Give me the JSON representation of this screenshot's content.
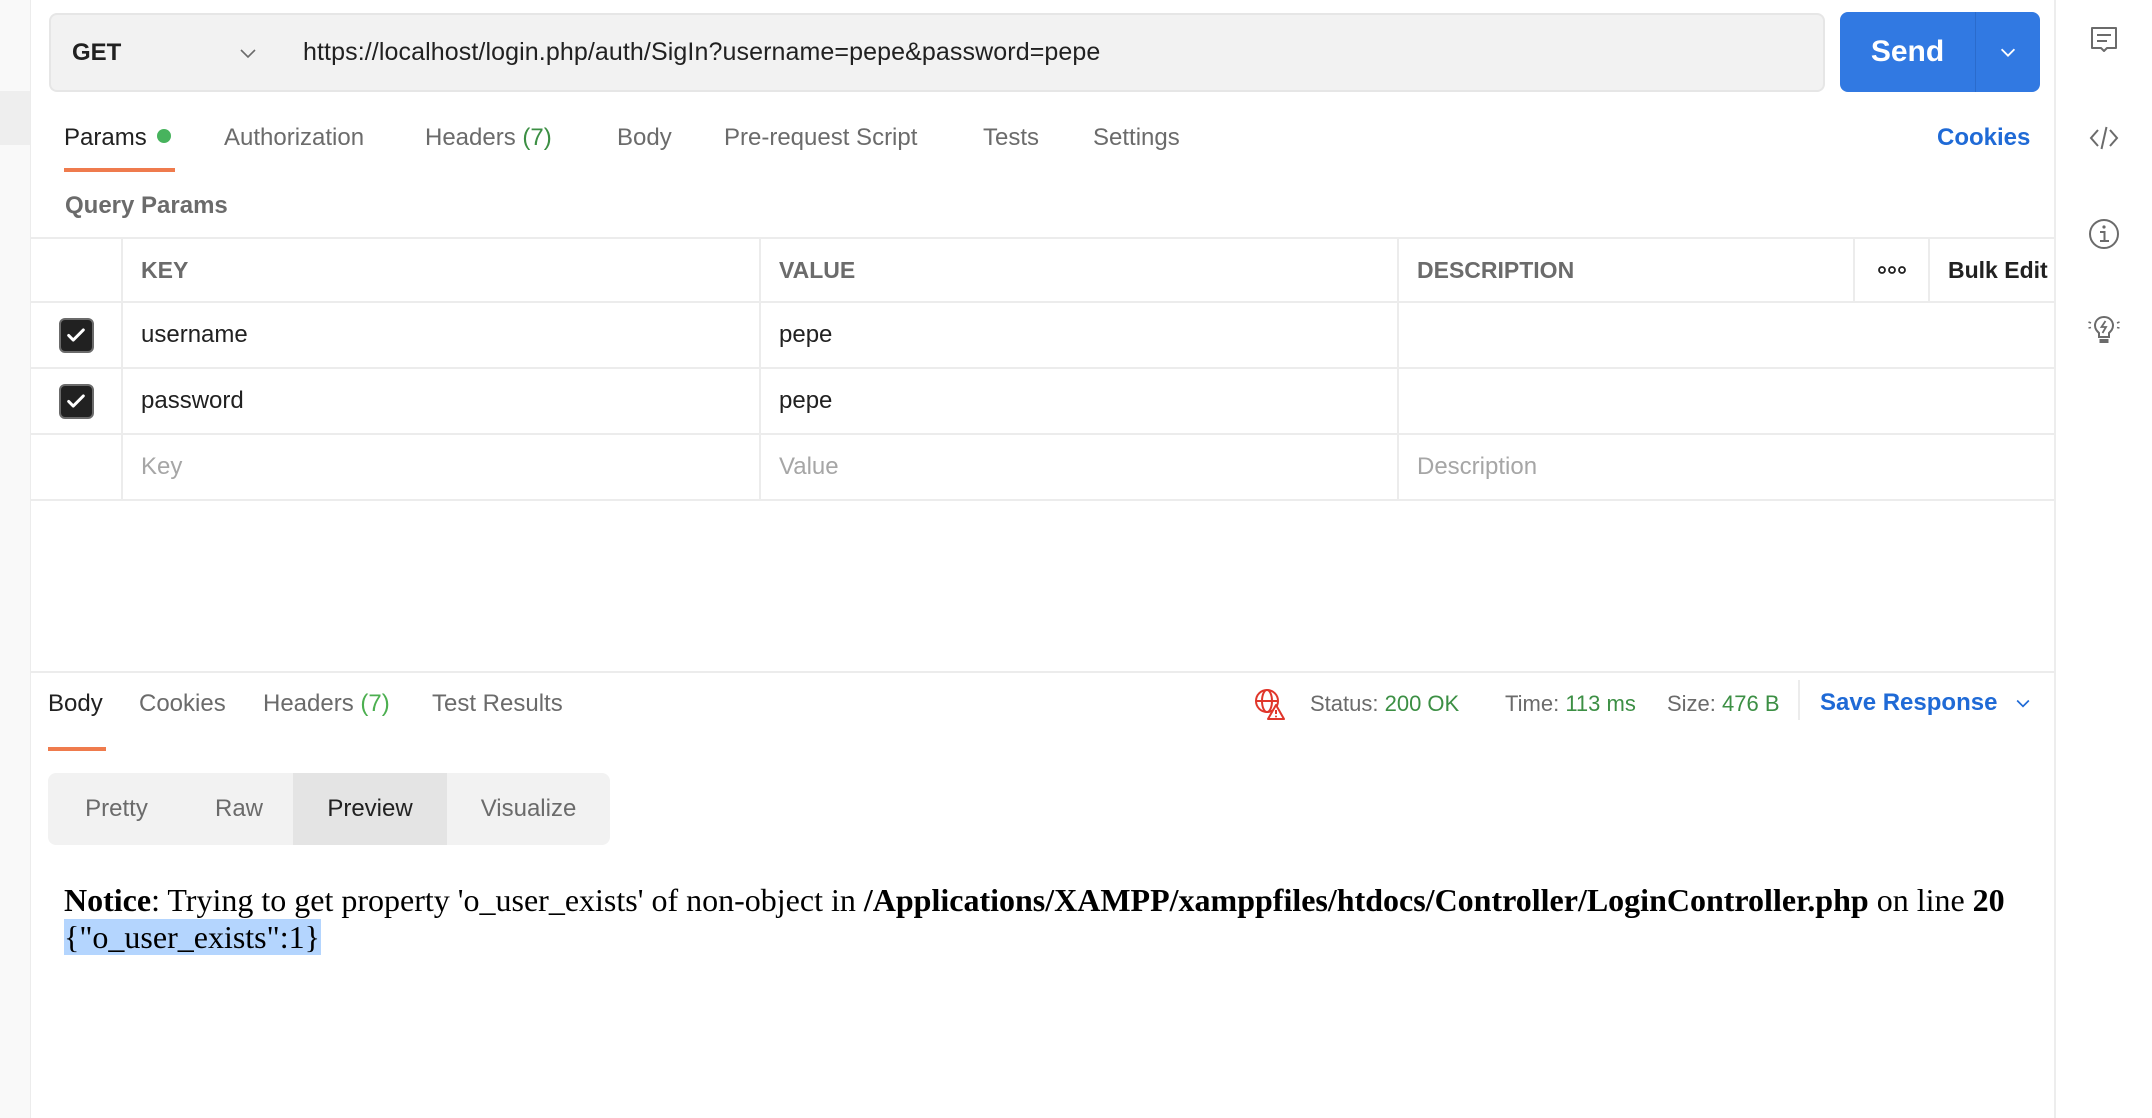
{
  "request": {
    "method": "GET",
    "url": "https://localhost/login.php/auth/SigIn?username=pepe&password=pepe",
    "send_label": "Send"
  },
  "request_tabs": [
    {
      "label": "Params",
      "active": true,
      "indicator": "green-dot"
    },
    {
      "label": "Authorization"
    },
    {
      "label": "Headers",
      "count": "(7)"
    },
    {
      "label": "Body"
    },
    {
      "label": "Pre-request Script"
    },
    {
      "label": "Tests"
    },
    {
      "label": "Settings"
    }
  ],
  "cookies_link": "Cookies",
  "query_params": {
    "title": "Query Params",
    "columns": {
      "key": "KEY",
      "value": "VALUE",
      "description": "DESCRIPTION",
      "more": "ooo",
      "bulk_edit": "Bulk Edit"
    },
    "rows": [
      {
        "checked": true,
        "key": "username",
        "value": "pepe",
        "description": ""
      },
      {
        "checked": true,
        "key": "password",
        "value": "pepe",
        "description": ""
      }
    ],
    "new_row_placeholders": {
      "key": "Key",
      "value": "Value",
      "description": "Description"
    }
  },
  "response": {
    "tabs": [
      {
        "label": "Body",
        "active": true
      },
      {
        "label": "Cookies"
      },
      {
        "label": "Headers",
        "count": "(7)"
      },
      {
        "label": "Test Results"
      }
    ],
    "status_label": "Status:",
    "status_value": "200 OK",
    "time_label": "Time:",
    "time_value": "113 ms",
    "size_label": "Size:",
    "size_value": "476 B",
    "save_response": "Save Response",
    "view_modes": [
      "Pretty",
      "Raw",
      "Preview",
      "Visualize"
    ],
    "active_view_mode": "Preview",
    "preview": {
      "notice_label": "Notice",
      "notice_text": ": Trying to get property 'o_user_exists' of non-object in ",
      "notice_path": "/Applications/XAMPP/xamppfiles/htdocs/Controller/LoginController.php",
      "notice_line_text": " on line ",
      "notice_line_number": "20",
      "json_output": "{\"o_user_exists\":1}"
    }
  },
  "sidebar_icons": [
    "comments-icon",
    "code-icon",
    "info-icon",
    "lightbulb-icon"
  ],
  "colors": {
    "accent_blue": "#3179e2",
    "link_blue": "#1f6ad6",
    "active_tab_underline": "#ef7b4d",
    "success_green": "#3c8f44",
    "error_red": "#e0362b",
    "selection": "#b4d5fe"
  }
}
